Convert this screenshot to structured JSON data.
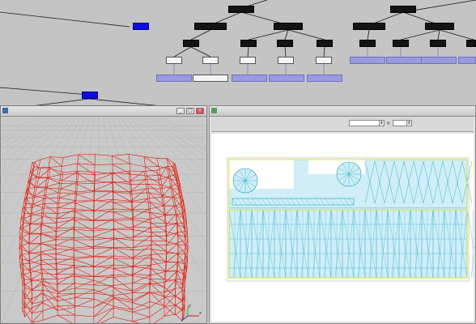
{
  "graph": {
    "nodes": {
      "left_floating": "",
      "tree1_root": "",
      "tree1_child_a": "",
      "tree1_child_b": "",
      "tree1_lvl2_a": "",
      "tree1_lvl2_b": "",
      "tree1_lvl2_c": "",
      "tree1_lvl3_a": "",
      "tree1_lvl3_b": "",
      "tree1_lvl3_c": "",
      "tree1_lvl3_d": "",
      "tree1_lvl3_e": "",
      "tree1_leaf_a": "",
      "tree1_leaf_b": "",
      "tree1_leaf_c": "",
      "tree1_leaf_d": "",
      "tree1_leaf_e": "",
      "tree1_leaf_f": "",
      "tree2_root": "",
      "tree2_child_a": "",
      "tree2_child_b": "",
      "tree2_lvl2_a": "",
      "tree2_lvl2_b": "",
      "tree2_lvl2_c": "",
      "tree2_lvl2_d": "",
      "tree2_leaf_a": "",
      "tree2_leaf_b": "",
      "tree2_leaf_c": "",
      "tree2_leaf_d": "",
      "tree2_leaf_e": "",
      "bottom_selected": ""
    },
    "colors": {
      "node_black": "#141414",
      "node_blue": "#9a9ae0",
      "node_selected": "#0c0ce0",
      "background": "#c4c4c4"
    }
  },
  "viewport": {
    "title": "",
    "buttons": {
      "minimize": "_",
      "maximize": "□",
      "close": "×"
    },
    "mesh_color": "#e61a0a",
    "axis_labels": {
      "x": "x",
      "y": "y"
    }
  },
  "uv_editor": {
    "title": "",
    "toolbar": {
      "mode_label": "",
      "u_label": "U",
      "v_label": "V",
      "u_value": "",
      "v_value": ""
    },
    "colors": {
      "wire": "#19a6c8",
      "fill": "#cfeef7",
      "edge_highlight": "#e8e800"
    }
  }
}
